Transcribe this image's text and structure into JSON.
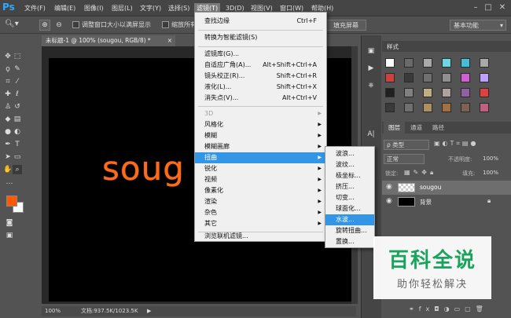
{
  "app": {
    "logo": "Ps"
  },
  "menubar": {
    "items": [
      "文件(F)",
      "编辑(E)",
      "图像(I)",
      "图层(L)",
      "文字(Y)",
      "选择(S)",
      "滤镜(T)",
      "3D(D)",
      "视图(V)",
      "窗口(W)",
      "帮助(H)"
    ],
    "active_index": 6
  },
  "window_controls": {
    "minimize": "–",
    "maximize": "□",
    "close": "✕"
  },
  "options": {
    "resize_window": "调整窗口大小以满屏显示",
    "zoom_all": "缩放所有",
    "fill_screen": "填充屏幕",
    "workspace": "基本功能"
  },
  "document": {
    "tab_label": "未标题-1 @ 100% (sougou, RGB/8) *",
    "tab_close": "×",
    "canvas_text": "soug",
    "zoom": "100%",
    "doc_info": "文档:937.5K/1023.5K"
  },
  "filter_menu": {
    "items": [
      {
        "label": "查找边缘",
        "shortcut": "Ctrl+F"
      },
      {
        "label": "转换为智能滤镜(S)"
      },
      {
        "label": "滤镜库(G)..."
      },
      {
        "label": "自适应广角(A)...",
        "shortcut": "Alt+Shift+Ctrl+A"
      },
      {
        "label": "镜头校正(R)...",
        "shortcut": "Shift+Ctrl+R"
      },
      {
        "label": "液化(L)...",
        "shortcut": "Shift+Ctrl+X"
      },
      {
        "label": "消失点(V)...",
        "shortcut": "Alt+Ctrl+V"
      },
      {
        "label": "3D",
        "disabled": true
      },
      {
        "label": "风格化"
      },
      {
        "label": "模糊"
      },
      {
        "label": "模糊画廊"
      },
      {
        "label": "扭曲",
        "highlighted": true
      },
      {
        "label": "锐化"
      },
      {
        "label": "视频"
      },
      {
        "label": "像素化"
      },
      {
        "label": "渲染"
      },
      {
        "label": "杂色"
      },
      {
        "label": "其它"
      },
      {
        "label": "浏览联机滤镜..."
      }
    ]
  },
  "distort_submenu": {
    "items": [
      "波浪...",
      "波纹...",
      "极坐标...",
      "挤压...",
      "切变...",
      "球面化...",
      "水波...",
      "旋转扭曲...",
      "置换..."
    ],
    "highlighted_index": 6
  },
  "styles_panel": {
    "title": "样式"
  },
  "layers_panel": {
    "tabs": [
      "图层",
      "通道",
      "路径"
    ],
    "filter_kind": "ρ 类型",
    "blend_mode": "正常",
    "opacity_label": "不透明度:",
    "opacity": "100%",
    "lock_label": "锁定:",
    "fill_label": "填充:",
    "fill": "100%",
    "layers": [
      {
        "name": "sougou",
        "selected": true
      },
      {
        "name": "背景",
        "selected": false
      }
    ],
    "footer_icons": [
      "link-icon",
      "fx-icon",
      "mask-icon",
      "adjustment-icon",
      "folder-icon",
      "new-layer-icon",
      "trash-icon"
    ]
  },
  "colors": {
    "foreground": "#ff5a00",
    "background": "#ffffff",
    "text_color": "#ff6a1a",
    "highlight": "#3295e6"
  },
  "watermark": {
    "title": "百科全说",
    "subtitle": "助你轻松解决"
  }
}
